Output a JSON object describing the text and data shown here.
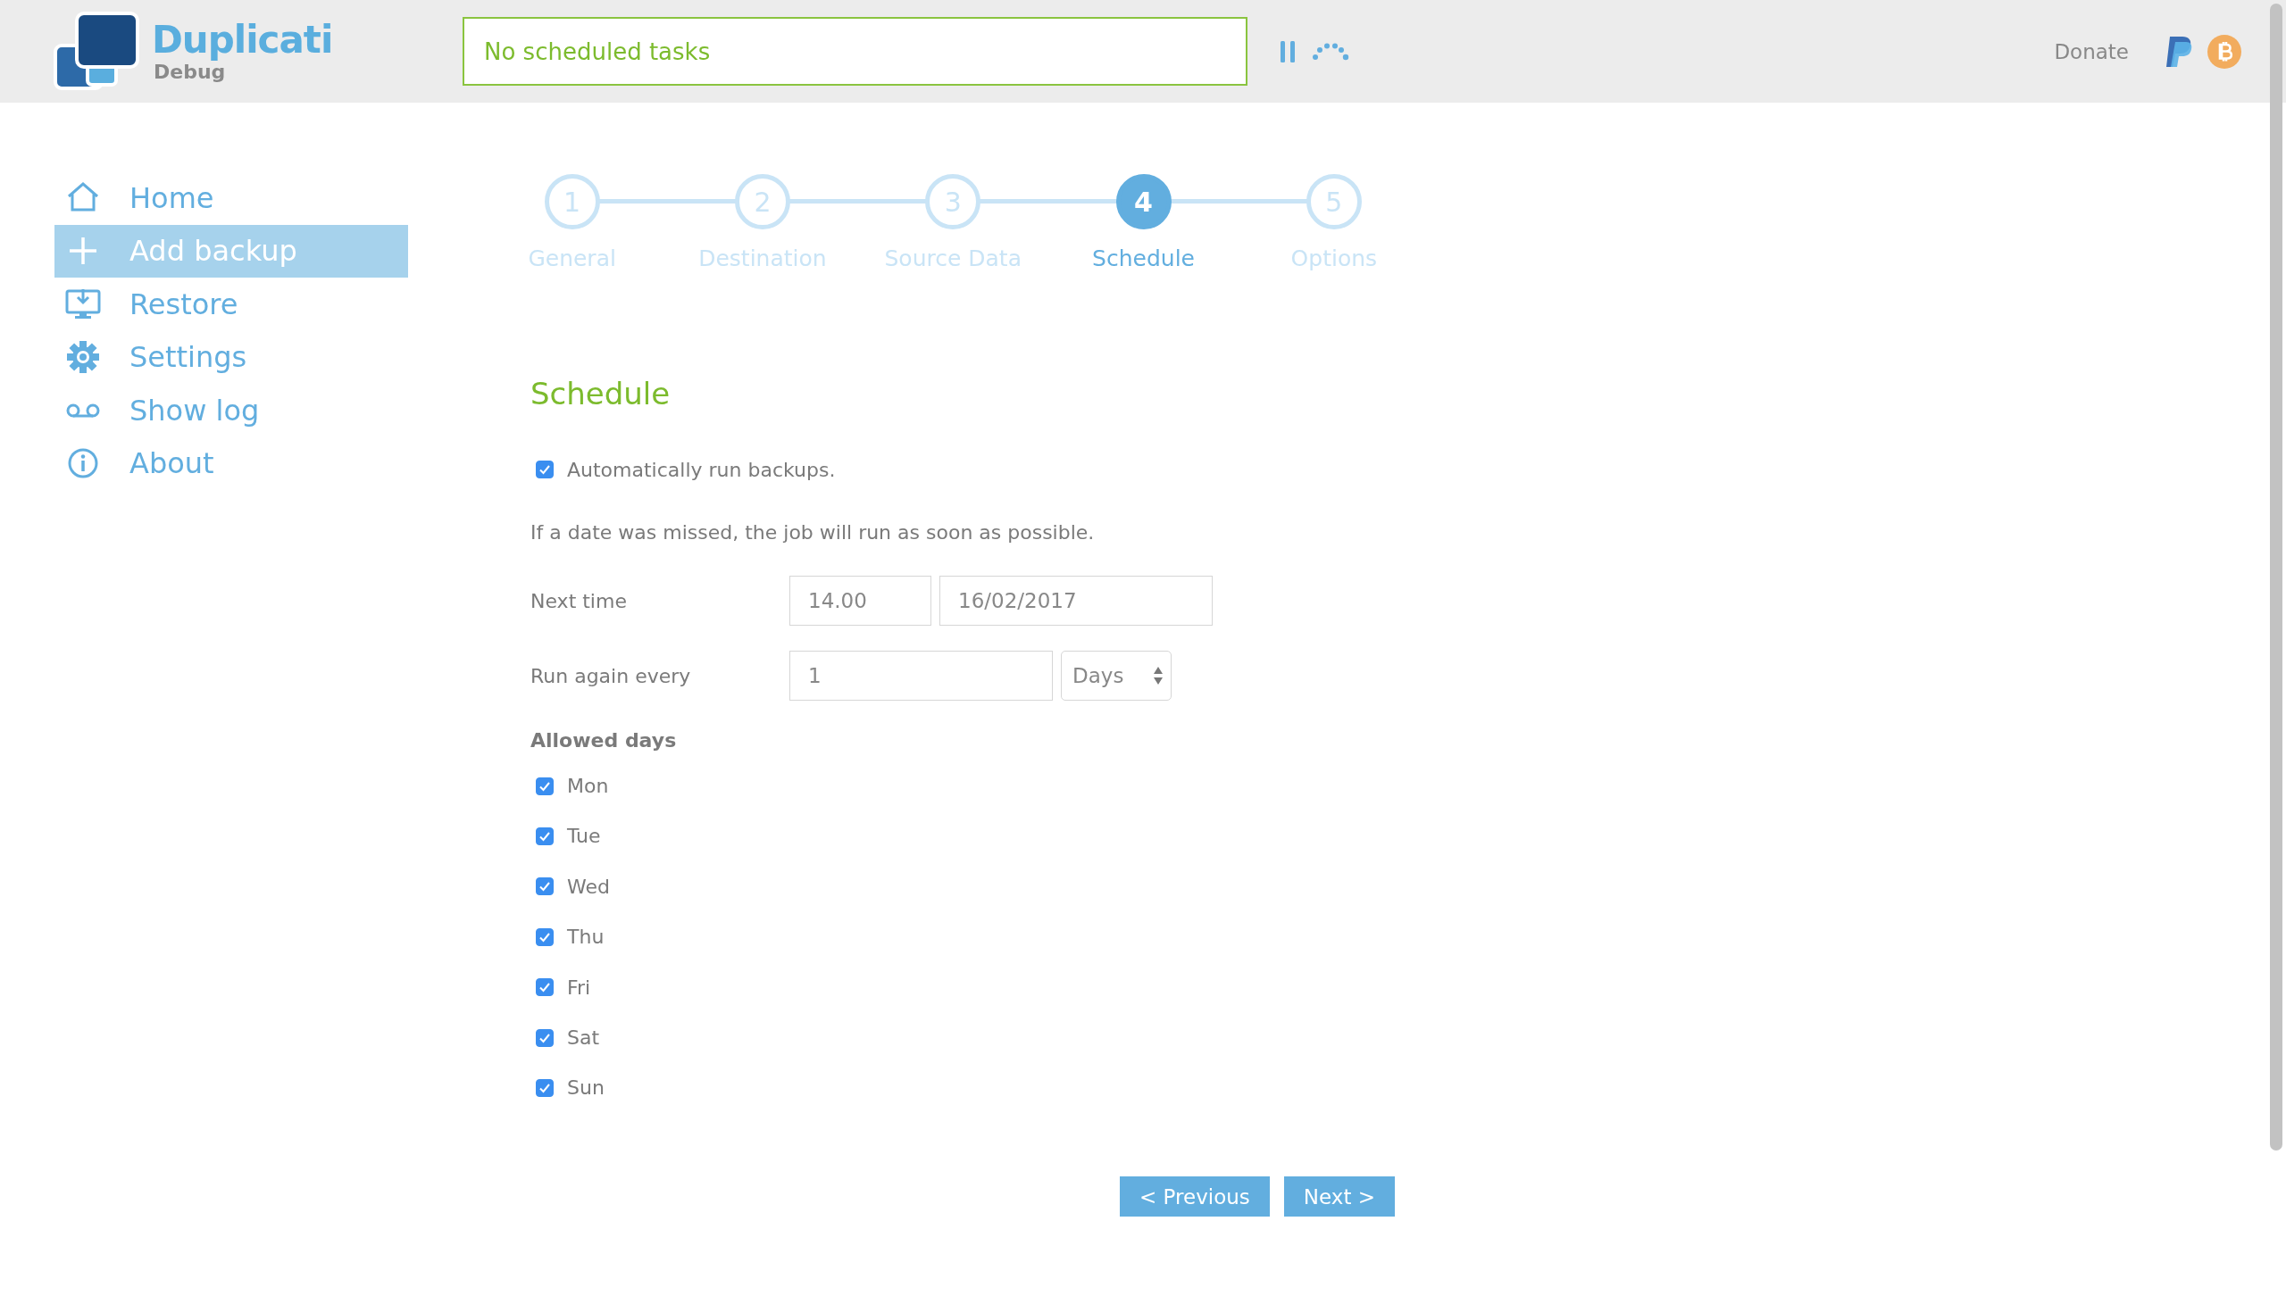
{
  "header": {
    "brand": "Duplicati",
    "subtitle": "Debug",
    "status": "No scheduled tasks",
    "donate": "Donate"
  },
  "sidebar": {
    "items": [
      {
        "label": "Home",
        "selected": false
      },
      {
        "label": "Add backup",
        "selected": true
      },
      {
        "label": "Restore",
        "selected": false
      },
      {
        "label": "Settings",
        "selected": false
      },
      {
        "label": "Show log",
        "selected": false
      },
      {
        "label": "About",
        "selected": false
      }
    ]
  },
  "steps": [
    {
      "number": "1",
      "label": "General",
      "selected": false
    },
    {
      "number": "2",
      "label": "Destination",
      "selected": false
    },
    {
      "number": "3",
      "label": "Source Data",
      "selected": false
    },
    {
      "number": "4",
      "label": "Schedule",
      "selected": true
    },
    {
      "number": "5",
      "label": "Options",
      "selected": false
    }
  ],
  "schedule": {
    "title": "Schedule",
    "auto_run": {
      "label": "Automatically run backups.",
      "checked": true
    },
    "note": "If a date was missed, the job will run as soon as possible.",
    "next_time": {
      "label": "Next time",
      "time": "14.00",
      "date": "16/02/2017"
    },
    "repeat": {
      "label": "Run again every",
      "value": "1",
      "unit": "Days"
    },
    "allowed_days": {
      "title": "Allowed days",
      "days": [
        {
          "label": "Mon",
          "checked": true
        },
        {
          "label": "Tue",
          "checked": true
        },
        {
          "label": "Wed",
          "checked": true
        },
        {
          "label": "Thu",
          "checked": true
        },
        {
          "label": "Fri",
          "checked": true
        },
        {
          "label": "Sat",
          "checked": true
        },
        {
          "label": "Sun",
          "checked": true
        }
      ]
    }
  },
  "buttons": [
    {
      "label": "< Previous"
    },
    {
      "label": "Next >"
    }
  ]
}
